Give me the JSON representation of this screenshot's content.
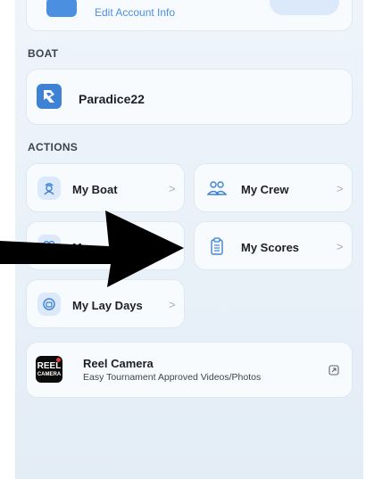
{
  "account": {
    "edit_label": "Edit Account Info"
  },
  "boat_section": {
    "heading": "BOAT",
    "boat_name": "Paradice22"
  },
  "actions_section": {
    "heading": "ACTIONS",
    "tiles": [
      {
        "label": "My Boat",
        "icon": "sailor-icon"
      },
      {
        "label": "My Crew",
        "icon": "people-icon"
      },
      {
        "label": "My ...",
        "icon": "people-icon"
      },
      {
        "label": "My Scores",
        "icon": "clipboard-icon"
      },
      {
        "label": "My Lay Days",
        "icon": "calendar-icon"
      }
    ],
    "chevron": ">"
  },
  "reel_camera": {
    "logo_line1": "REEL",
    "logo_line2": "CAMERA",
    "title": "Reel Camera",
    "subtitle": "Easy Tournament Approved Videos/Photos"
  },
  "colors": {
    "accent": "#3d82d4",
    "icon_bg": "#dbe9fb",
    "arrow": "#000000"
  }
}
